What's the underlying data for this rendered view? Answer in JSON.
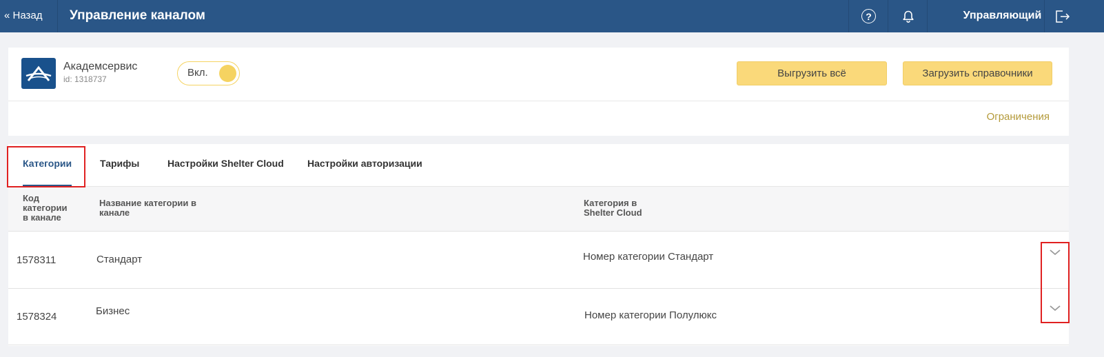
{
  "header": {
    "back_label": "« Назад",
    "title": "Управление каналом",
    "help_icon_glyph": "?",
    "role_label": "Управляющий"
  },
  "channel": {
    "name": "Академсервис",
    "id_label": "id: 1318737",
    "toggle_label": "Вкл.",
    "toggle_on": true,
    "export_all_label": "Выгрузить всё",
    "load_refs_label": "Загрузить справочники",
    "limits_link": "Ограничения"
  },
  "tabs": [
    {
      "label": "Категории",
      "active": true
    },
    {
      "label": "Тарифы",
      "active": false
    },
    {
      "label": "Настройки Shelter Cloud",
      "active": false
    },
    {
      "label": "Настройки авторизации",
      "active": false
    }
  ],
  "table": {
    "columns": {
      "code": [
        "Код",
        "категории",
        "в канале"
      ],
      "name": [
        "Название категории в",
        "канале"
      ],
      "shelter": [
        "Категория в",
        "Shelter Cloud"
      ]
    },
    "rows": [
      {
        "code": "1578311",
        "name": "Стандарт",
        "shelter": "Номер категории Стандарт"
      },
      {
        "code": "1578324",
        "name": "Бизнес",
        "shelter": "Номер категории Полулюкс"
      }
    ]
  },
  "colors": {
    "header_bg": "#2a5687",
    "accent_yellow": "#fad97a",
    "link_gold": "#b49a3a",
    "highlight_red": "#e02020"
  },
  "icons": {
    "help": "help-icon",
    "bell": "bell-icon",
    "logout": "logout-icon",
    "logo": "akademservice-logo-icon",
    "expand": "chevron-down-icon"
  }
}
